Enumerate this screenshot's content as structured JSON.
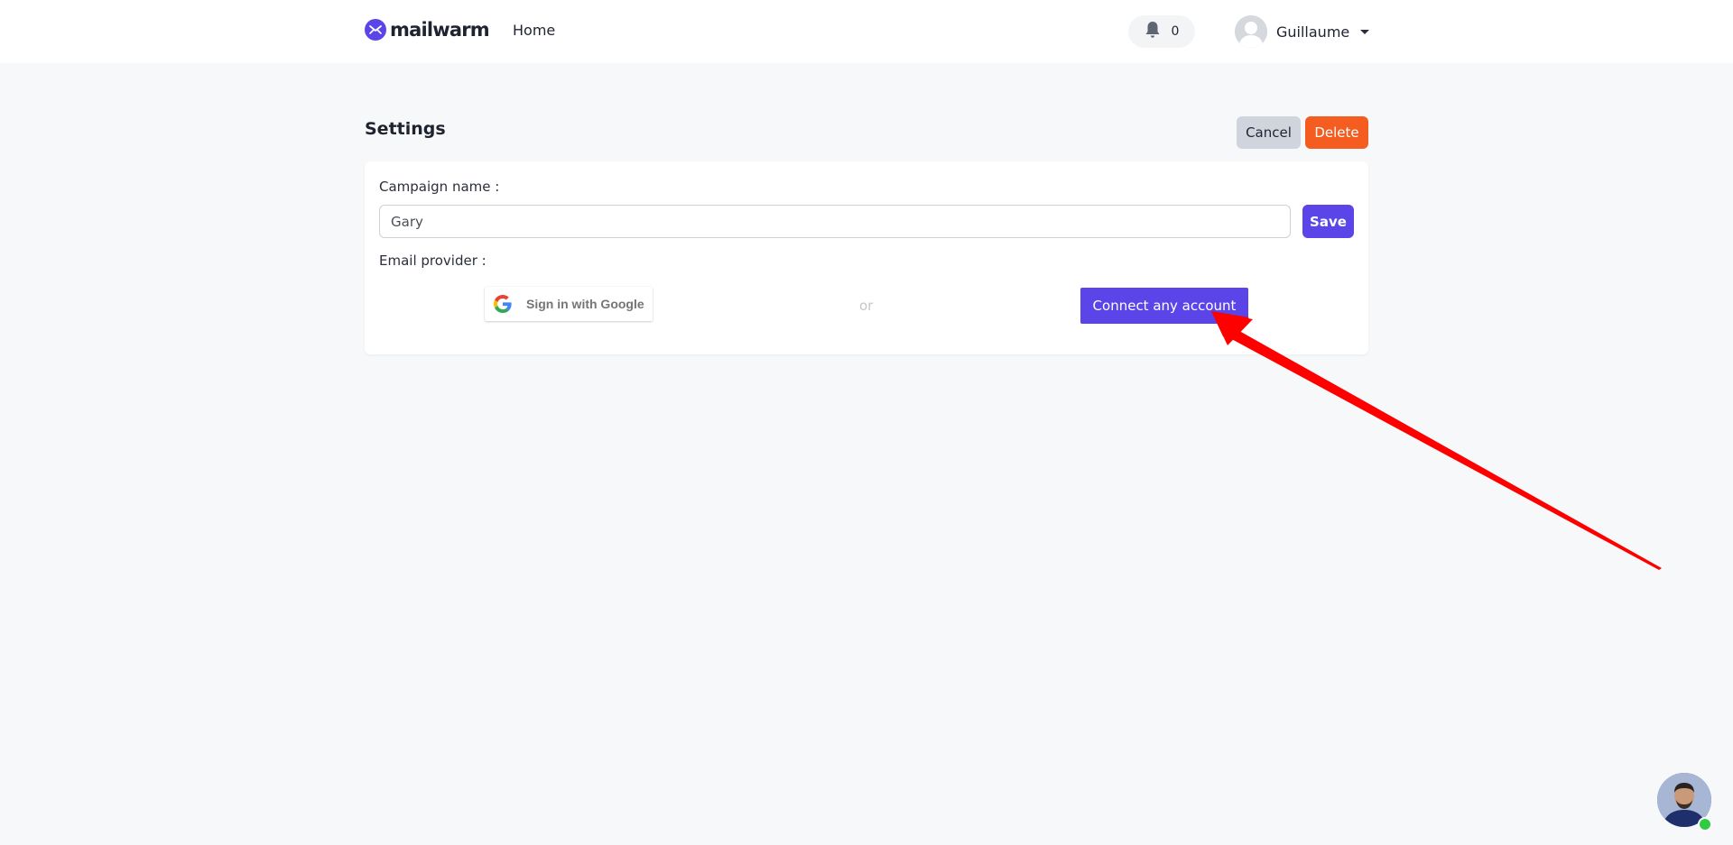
{
  "header": {
    "brand_name": "mailwarm",
    "nav_home": "Home",
    "notification_count": "0",
    "user_name": "Guillaume"
  },
  "page": {
    "title": "Settings",
    "cancel_label": "Cancel",
    "delete_label": "Delete"
  },
  "form": {
    "campaign_label": "Campaign name :",
    "campaign_value": "Gary",
    "save_label": "Save",
    "provider_label": "Email provider :",
    "google_label": "Sign in with Google",
    "or_text": "or",
    "connect_label": "Connect any account"
  },
  "colors": {
    "accent": "#5b45e8",
    "delete": "#f45d1f",
    "cancel": "#cfd5dd",
    "background": "#f7f8fa",
    "annotation_arrow": "#ff0000"
  },
  "icons": {
    "brand": "mailwarm-logo-icon",
    "notification": "bell-icon",
    "user": "avatar-icon",
    "menu": "chevron-down-icon",
    "google": "google-icon",
    "chat": "support-avatar-icon"
  }
}
